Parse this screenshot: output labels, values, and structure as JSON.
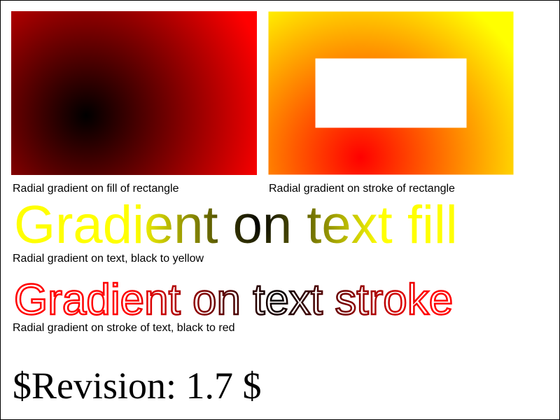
{
  "gradients": {
    "fill_rect": {
      "center_color": "#000000",
      "edge_color": "#ff0000"
    },
    "stroke_rect": {
      "center_color": "#ff0000",
      "edge_color": "#ffff00"
    },
    "text_fill": {
      "center_color": "#000000",
      "edge_color": "#ffff00"
    },
    "text_stroke": {
      "center_color": "#000000",
      "edge_color": "#ff0000"
    }
  },
  "panels": {
    "fill_caption": "Radial gradient on fill of rectangle",
    "stroke_caption": "Radial gradient on stroke of rectangle"
  },
  "text_fill_demo": {
    "text": "Gradient on text fill",
    "caption": "Radial gradient on text, black to yellow"
  },
  "text_stroke_demo": {
    "text": "Gradient on text stroke",
    "caption": "Radial gradient on stroke of text, black to red"
  },
  "revision": "$Revision: 1.7 $"
}
